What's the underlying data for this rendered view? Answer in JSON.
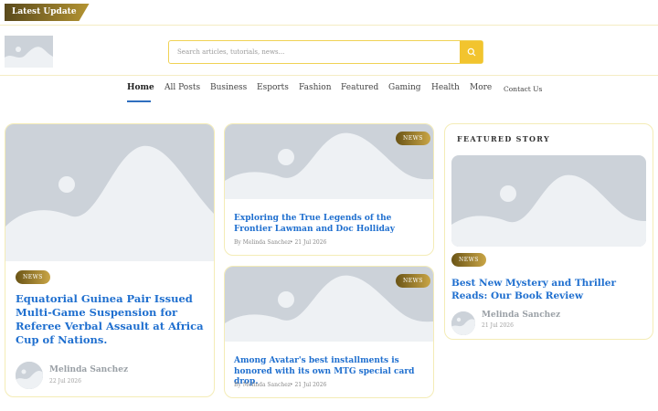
{
  "topbar": {
    "latest_label": "Latest Update"
  },
  "search": {
    "placeholder": "Search articles, tutorials, news..."
  },
  "nav": {
    "items": [
      "Home",
      "All Posts",
      "Business",
      "Esports",
      "Fashion",
      "Featured",
      "Gaming",
      "Health",
      "More",
      "Contact Us"
    ],
    "active": "Home"
  },
  "main_article": {
    "tag": "NEWS",
    "title": "Equatorial Guinea Pair Issued Multi-Game Suspension for Referee Verbal Assault at Africa Cup of Nations.",
    "author": "Melinda Sanchez",
    "date": "22 Jul 2026"
  },
  "middle_articles": [
    {
      "tag": "NEWS",
      "title": "Exploring the True Legends of the Frontier Lawman and Doc Holliday",
      "author": "By Melinda Sanchez",
      "date": "• 21 Jul 2026"
    },
    {
      "tag": "NEWS",
      "title": "Among Avatar's best installments is honored with its own MTG special card drop.",
      "author": "By Melinda Sanchez",
      "date": "• 21 Jul 2026"
    }
  ],
  "featured": {
    "section_label": "FEATURED STORY",
    "tag": "NEWS",
    "title": "Best New Mystery and Thriller Reads: Our Book Review",
    "author": "Melinda Sanchez",
    "date": "21 Jul 2026"
  },
  "colors": {
    "accent_gold": "#c9a546",
    "search_button": "#f2c42e",
    "link_blue": "#1f6fcf",
    "placeholder_gray": "#ccd2d9"
  },
  "icons": {
    "search_button": "search-icon"
  }
}
